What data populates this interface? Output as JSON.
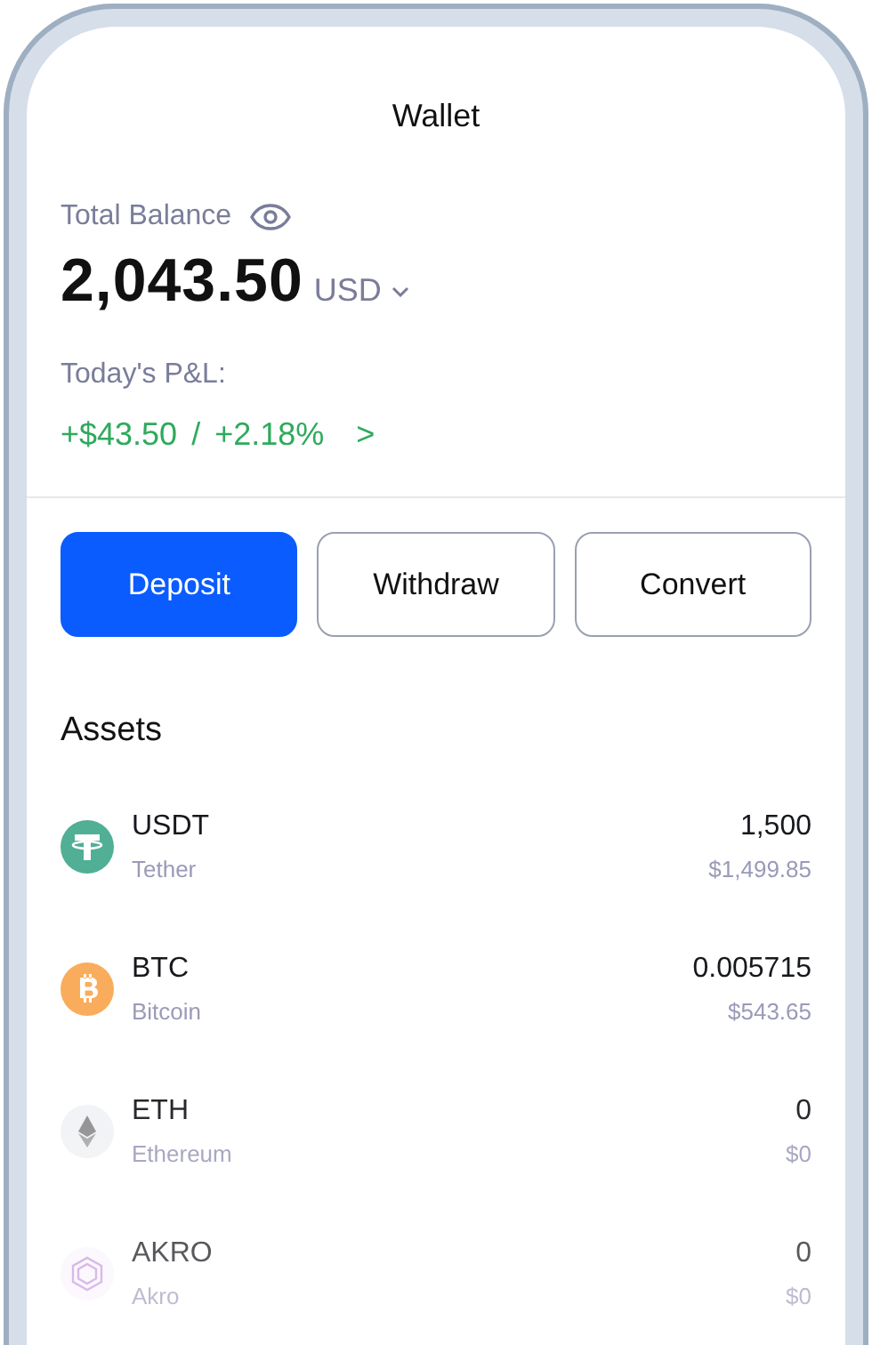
{
  "header": {
    "title": "Wallet"
  },
  "balance": {
    "label": "Total Balance",
    "amount": "2,043.50",
    "currency": "USD"
  },
  "pnl": {
    "label": "Today's P&L:",
    "amount": "+$43.50",
    "separator": "/",
    "percent": "+2.18%",
    "arrow": ">"
  },
  "buttons": [
    {
      "label": "Deposit",
      "selected": true
    },
    {
      "label": "Withdraw",
      "selected": false
    },
    {
      "label": "Convert",
      "selected": false
    }
  ],
  "assets": {
    "title": "Assets",
    "items": [
      {
        "kind": "tether",
        "symbol": "USDT",
        "name": "Tether",
        "amount": "1,500",
        "value": "$1,499.85"
      },
      {
        "kind": "bitcoin",
        "symbol": "BTC",
        "name": "Bitcoin",
        "amount": "0.005715",
        "value": "$543.65"
      },
      {
        "kind": "ethereum",
        "symbol": "ETH",
        "name": "Ethereum",
        "amount": "0",
        "value": "$0"
      },
      {
        "kind": "akro",
        "symbol": "AKRO",
        "name": "Akro",
        "amount": "0",
        "value": "$0"
      }
    ]
  }
}
